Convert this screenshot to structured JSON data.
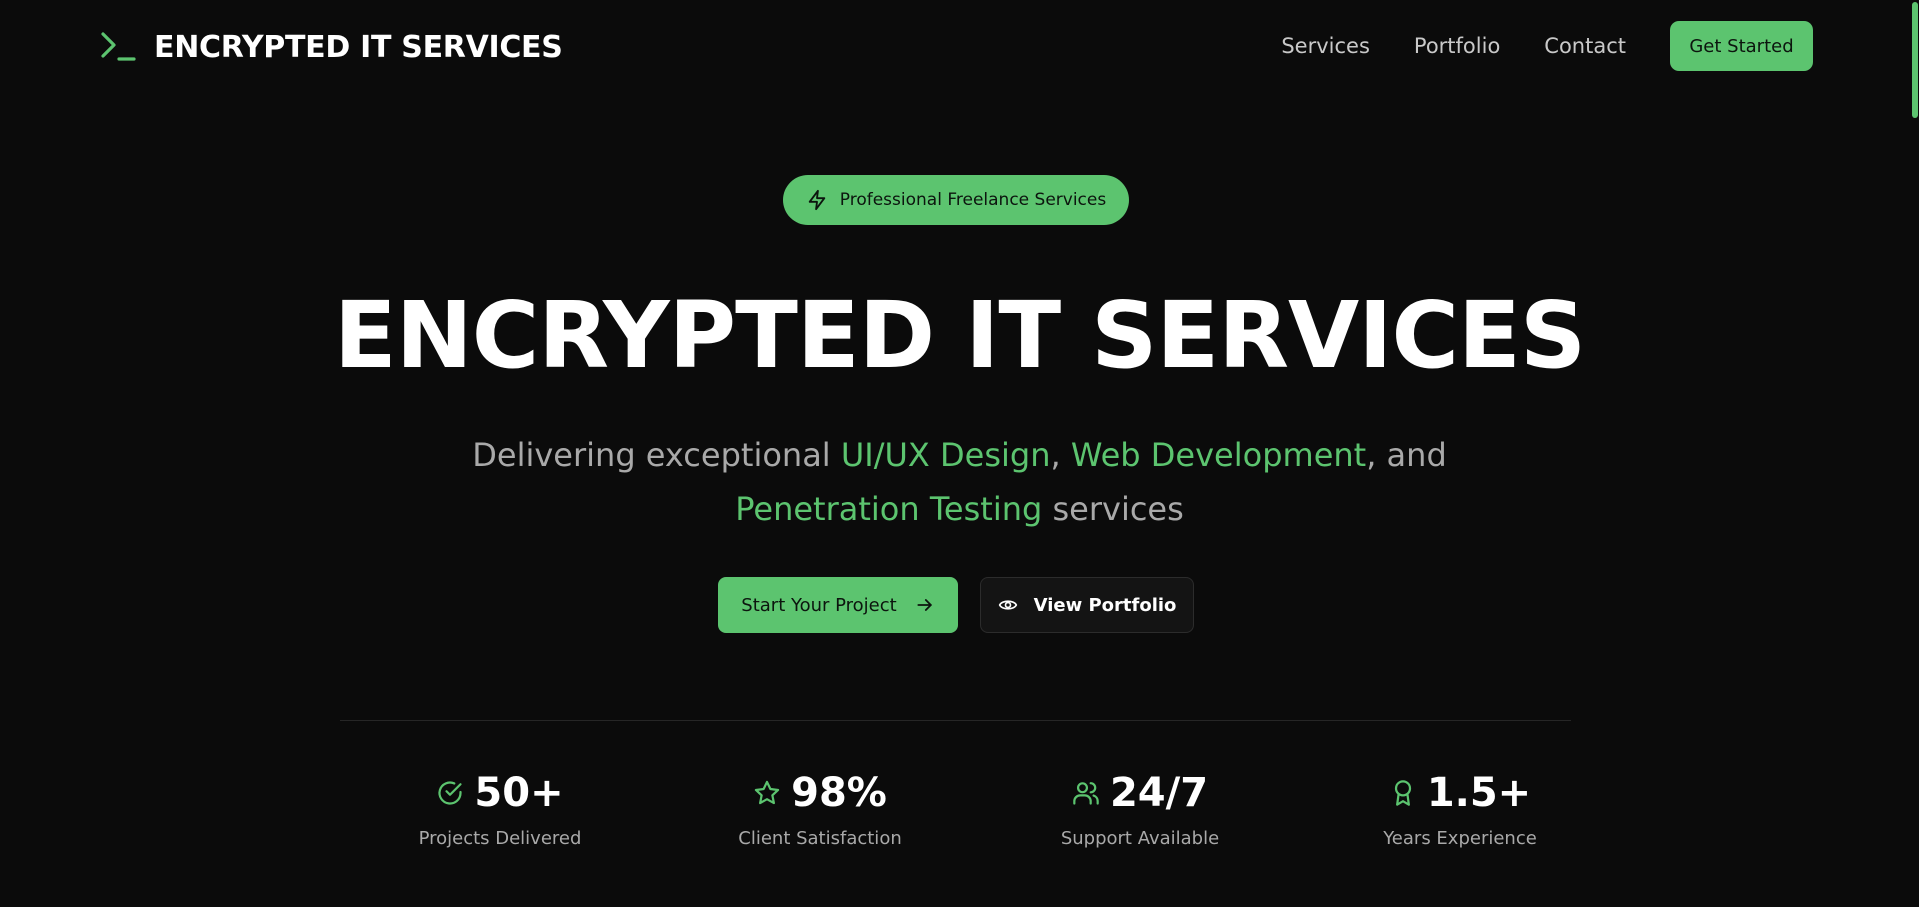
{
  "nav": {
    "brand": "ENCRYPTED IT SERVICES",
    "brand_icon": "terminal-prompt-icon",
    "links": [
      "Services",
      "Portfolio",
      "Contact"
    ],
    "cta": "Get Started"
  },
  "hero": {
    "badge": "Professional Freelance Services",
    "badge_icon": "lightning-icon",
    "title": "ENCRYPTED IT SERVICES",
    "subtitle": {
      "part1": "Delivering exceptional ",
      "hl1": "UI/UX Design",
      "part2": ", ",
      "hl2": "Web Development",
      "part3": ", and ",
      "hl3": "Penetration Testing",
      "part4": " services"
    },
    "primary_button": "Start Your Project",
    "secondary_button": "View Portfolio"
  },
  "stats": [
    {
      "icon": "check-circle-icon",
      "value": "50+",
      "label": "Projects Delivered"
    },
    {
      "icon": "star-icon",
      "value": "98%",
      "label": "Client Satisfaction"
    },
    {
      "icon": "users-icon",
      "value": "24/7",
      "label": "Support Available"
    },
    {
      "icon": "award-icon",
      "value": "1.5+",
      "label": "Years Experience"
    }
  ],
  "colors": {
    "background": "#0b0b0b",
    "accent": "#5cc46f",
    "muted_text": "#a9a9a9"
  }
}
